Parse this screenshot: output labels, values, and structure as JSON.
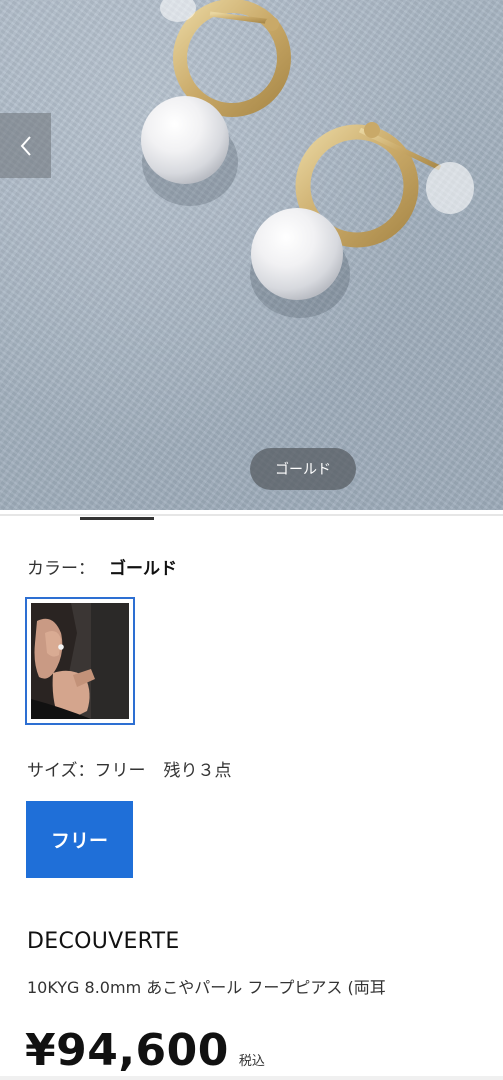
{
  "hero": {
    "prev_icon": "chevron-left-icon",
    "color_label": "ゴールド"
  },
  "color": {
    "label": "カラー：",
    "value": "ゴールド"
  },
  "size": {
    "label": "サイズ：フリー",
    "stock": "残り３点",
    "option": "フリー"
  },
  "product": {
    "brand": "DECOUVERTE",
    "name": "10KYG 8.0mm あこやパール フープピアス (両耳",
    "price": "¥94,600",
    "tax_label": "税込"
  },
  "colors": {
    "accent": "#1f6fd8",
    "selected_border": "#2d6fd2"
  }
}
